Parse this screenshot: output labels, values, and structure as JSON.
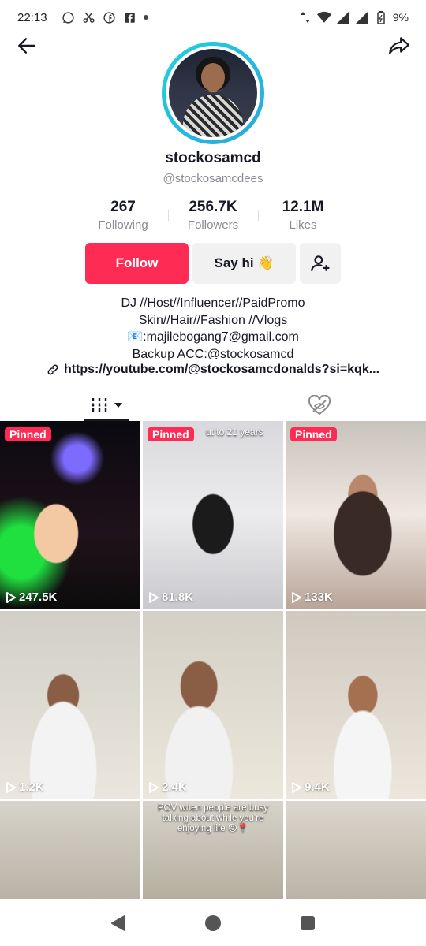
{
  "status_bar": {
    "time": "22:13",
    "battery": "9%"
  },
  "profile": {
    "username": "stockosamcd",
    "handle": "@stockosamcdees",
    "stats": [
      {
        "value": "267",
        "label": "Following"
      },
      {
        "value": "256.7K",
        "label": "Followers"
      },
      {
        "value": "12.1M",
        "label": "Likes"
      }
    ],
    "follow_label": "Follow",
    "say_hi_label": "Say hi 👋",
    "bio_lines": [
      "DJ //Host//Influencer//PaidPromo",
      "Skin//Hair//Fashion //Vlogs",
      "📧:majilebogang7@gmail.com",
      "Backup ACC:@stockosamcd"
    ],
    "link": "https://youtube.com/@stockosamcdonalds?si=kqk..."
  },
  "videos": [
    {
      "pinned": "Pinned",
      "views": "247.5K",
      "overlay": ""
    },
    {
      "pinned": "Pinned",
      "views": "81.8K",
      "overlay": "ut to 21 years"
    },
    {
      "pinned": "Pinned",
      "views": "133K",
      "overlay": ""
    },
    {
      "pinned": "",
      "views": "1.2K",
      "overlay": ""
    },
    {
      "pinned": "",
      "views": "2.4K",
      "overlay": ""
    },
    {
      "pinned": "",
      "views": "9.4K",
      "overlay": ""
    },
    {
      "pinned": "",
      "views": "",
      "overlay": ""
    },
    {
      "pinned": "",
      "views": "",
      "overlay": "POV when people are busy talking about while you're enjoying life 😝📍"
    },
    {
      "pinned": "",
      "views": "",
      "overlay": ""
    }
  ],
  "colors": {
    "accent": "#fe2c55",
    "ring": "#1fd1e0",
    "text": "#161823",
    "secondary": "#8a8b91"
  }
}
